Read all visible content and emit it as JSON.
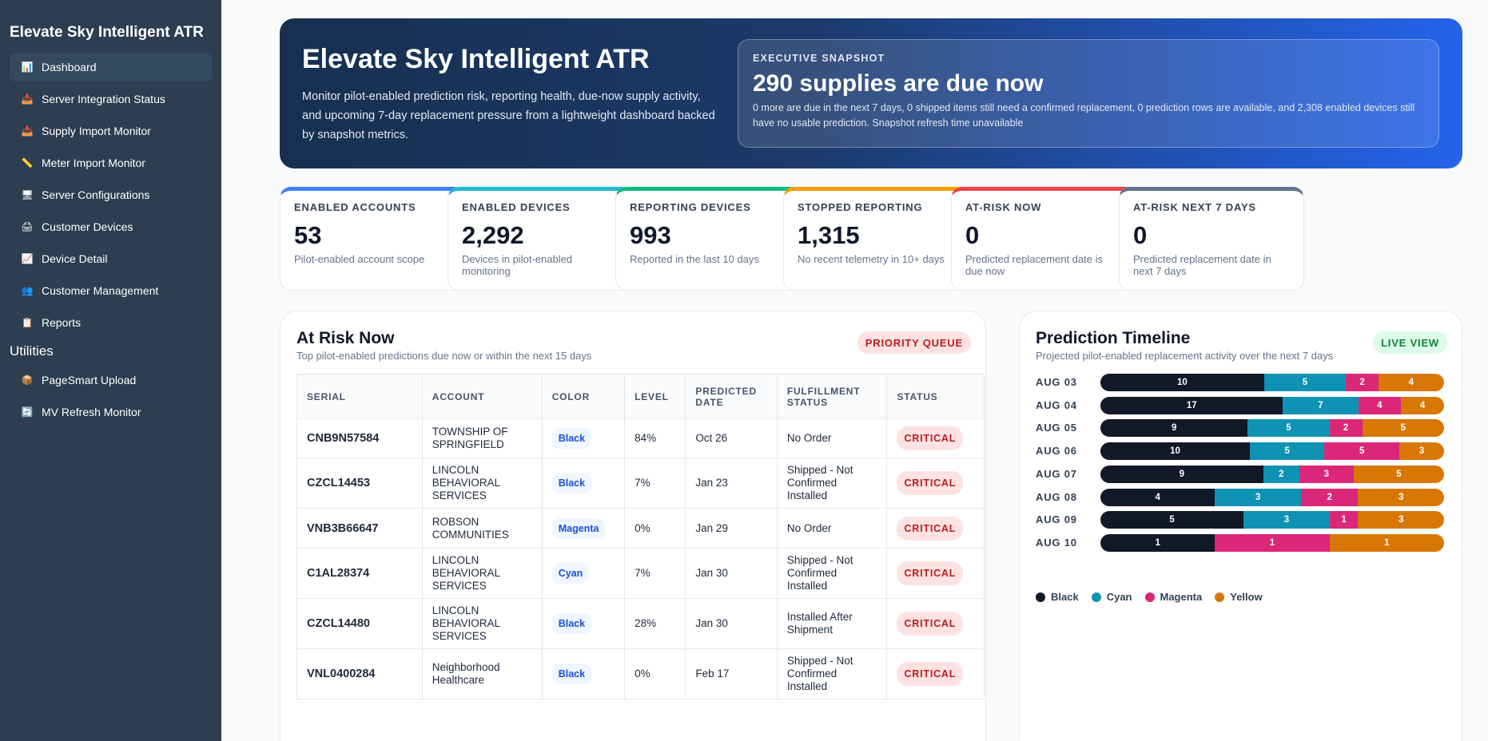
{
  "sidebar": {
    "brand": "Elevate Sky Intelligent ATR",
    "items": [
      {
        "label": "Dashboard",
        "icon": "📊"
      },
      {
        "label": "Server Integration Status",
        "icon": "📥"
      },
      {
        "label": "Supply Import Monitor",
        "icon": "📥"
      },
      {
        "label": "Meter Import Monitor",
        "icon": "📏"
      },
      {
        "label": "Server Configurations",
        "icon": "🖥"
      },
      {
        "label": "Customer Devices",
        "icon": "🖨"
      },
      {
        "label": "Device Detail",
        "icon": "📈"
      },
      {
        "label": "Customer Management",
        "icon": "👥"
      },
      {
        "label": "Reports",
        "icon": "📋"
      }
    ],
    "utilities_heading": "Utilities",
    "utilities": [
      {
        "label": "PageSmart Upload",
        "icon": "📦"
      },
      {
        "label": "MV Refresh Monitor",
        "icon": "🔄"
      }
    ]
  },
  "hero": {
    "title": "Elevate Sky Intelligent ATR",
    "description": "Monitor pilot-enabled prediction risk, reporting health, due-now supply activity, and upcoming 7-day replacement pressure from a lightweight dashboard backed by snapshot metrics.",
    "snapshot": {
      "label": "EXECUTIVE SNAPSHOT",
      "headline": "290 supplies are due now",
      "detail": "0 more are due in the next 7 days, 0 shipped items still need a confirmed replacement, 0 prediction rows are available, and 2,308 enabled devices still have no usable prediction. Snapshot refresh time unavailable"
    }
  },
  "cards": [
    {
      "label": "ENABLED ACCOUNTS",
      "value": "53",
      "desc": "Pilot-enabled account scope",
      "color": "#3b82f6"
    },
    {
      "label": "ENABLED DEVICES",
      "value": "2,292",
      "desc": "Devices in pilot-enabled monitoring",
      "color": "#22b8cf"
    },
    {
      "label": "REPORTING DEVICES",
      "value": "993",
      "desc": "Reported in the last 10 days",
      "color": "#10b981"
    },
    {
      "label": "STOPPED REPORTING",
      "value": "1,315",
      "desc": "No recent telemetry in 10+ days",
      "color": "#f59e0b"
    },
    {
      "label": "AT-RISK NOW",
      "value": "0",
      "desc": "Predicted replacement date is due now",
      "color": "#ef4444"
    },
    {
      "label": "AT-RISK NEXT 7 DAYS",
      "value": "0",
      "desc": "Predicted replacement date in next 7 days",
      "color": "#64748b"
    }
  ],
  "risk": {
    "title": "At Risk Now",
    "subtitle": "Top pilot-enabled predictions due now or within the next 15 days",
    "badge": "PRIORITY QUEUE",
    "columns": [
      "SERIAL",
      "ACCOUNT",
      "COLOR",
      "LEVEL",
      "PREDICTED DATE",
      "FULFILLMENT STATUS",
      "STATUS"
    ],
    "rows": [
      {
        "serial": "CNB9N57584",
        "account": "TOWNSHIP OF SPRINGFIELD",
        "color": "Black",
        "level": "84%",
        "date": "Oct 26",
        "fulfillment": "No Order",
        "status": "CRITICAL"
      },
      {
        "serial": "CZCL14453",
        "account": "LINCOLN BEHAVIORAL SERVICES",
        "color": "Black",
        "level": "7%",
        "date": "Jan 23",
        "fulfillment": "Shipped - Not Confirmed Installed",
        "status": "CRITICAL"
      },
      {
        "serial": "VNB3B66647",
        "account": "ROBSON COMMUNITIES",
        "color": "Magenta",
        "level": "0%",
        "date": "Jan 29",
        "fulfillment": "No Order",
        "status": "CRITICAL"
      },
      {
        "serial": "C1AL28374",
        "account": "LINCOLN BEHAVIORAL SERVICES",
        "color": "Cyan",
        "level": "7%",
        "date": "Jan 30",
        "fulfillment": "Shipped - Not Confirmed Installed",
        "status": "CRITICAL"
      },
      {
        "serial": "CZCL14480",
        "account": "LINCOLN BEHAVIORAL SERVICES",
        "color": "Black",
        "level": "28%",
        "date": "Jan 30",
        "fulfillment": "Installed After Shipment",
        "status": "CRITICAL"
      },
      {
        "serial": "VNL0400284",
        "account": "Neighborhood Healthcare",
        "color": "Black",
        "level": "0%",
        "date": "Feb 17",
        "fulfillment": "Shipped - Not Confirmed Installed",
        "status": "CRITICAL"
      }
    ]
  },
  "timeline": {
    "title": "Prediction Timeline",
    "subtitle": "Projected pilot-enabled replacement activity over the next 7 days",
    "badge": "LIVE VIEW",
    "legend": [
      {
        "name": "Black",
        "color": "#111827"
      },
      {
        "name": "Cyan",
        "color": "#0e93b5"
      },
      {
        "name": "Magenta",
        "color": "#db2777"
      },
      {
        "name": "Yellow",
        "color": "#d97706"
      }
    ]
  },
  "chart_data": {
    "type": "bar",
    "orientation": "horizontal-stacked",
    "categories": [
      "AUG 03",
      "AUG 04",
      "AUG 05",
      "AUG 06",
      "AUG 07",
      "AUG 08",
      "AUG 09",
      "AUG 10"
    ],
    "series": [
      {
        "name": "Black",
        "values": [
          10,
          17,
          9,
          10,
          9,
          4,
          5,
          1
        ]
      },
      {
        "name": "Cyan",
        "values": [
          5,
          7,
          5,
          5,
          2,
          3,
          3,
          0
        ]
      },
      {
        "name": "Magenta",
        "values": [
          2,
          4,
          2,
          5,
          3,
          2,
          1,
          1
        ]
      },
      {
        "name": "Yellow",
        "values": [
          4,
          4,
          5,
          3,
          5,
          3,
          3,
          1
        ]
      }
    ]
  }
}
